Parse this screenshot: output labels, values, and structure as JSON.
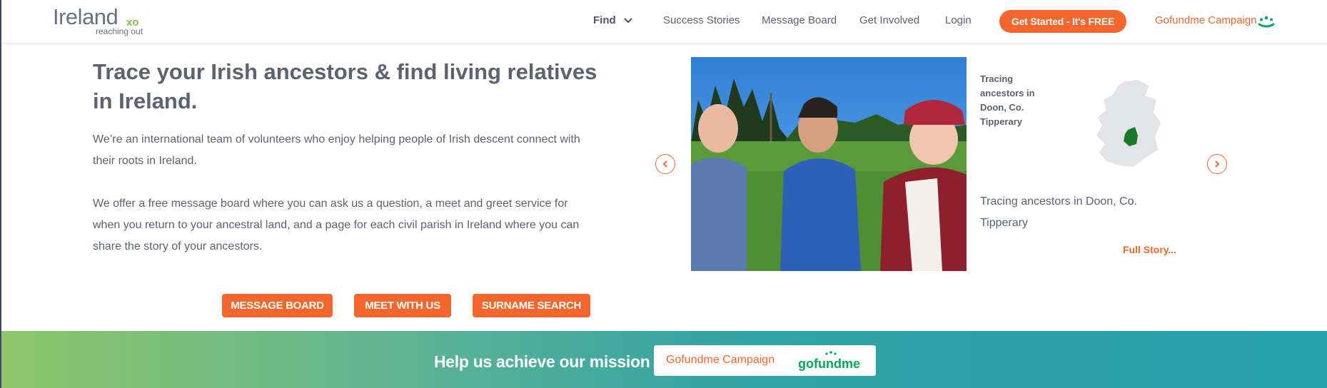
{
  "header": {
    "logo": {
      "main": "Ireland",
      "mark": "xo",
      "tagline": "reaching out"
    },
    "nav": {
      "find": "Find",
      "success_stories": "Success Stories",
      "message_board": "Message Board",
      "get_involved": "Get Involved",
      "login": "Login"
    },
    "cta": "Get Started - It's FREE",
    "gofundme_link": "Gofundme Campaign"
  },
  "hero": {
    "title": "Trace your Irish ancestors & find living relatives in Ireland.",
    "paragraph1": "We’re an international team of volunteers who enjoy helping people of Irish descent connect with their roots in Ireland.",
    "paragraph2": "We offer a free message board where you can ask us a question, a meet and greet service for when you return to your ancestral land, and a page for each civil parish in Ireland where you can share the story of your ancestors.",
    "buttons": {
      "message_board": "MESSAGE BOARD",
      "meet_with_us": "MEET WITH US",
      "surname_search": "SURNAME SEARCH"
    }
  },
  "carousel": {
    "story_title": "Tracing ancestors in Doon, Co. Tipperary",
    "story_description": "Tracing ancestors in Doon, Co. Tipperary",
    "full_story": "Full Story...",
    "prev_icon": "chevron-left-icon",
    "next_icon": "chevron-right-icon"
  },
  "banner": {
    "text": "Help us achieve our mission",
    "button": "Gofundme Campaign",
    "logo": "gofundme"
  },
  "colors": {
    "accent": "#f4662b",
    "text": "#5b6270",
    "logo_green": "#7cc243",
    "gofundme_green": "#02a95c",
    "banner_start": "#8fc66a",
    "banner_end": "#23a0a8"
  }
}
